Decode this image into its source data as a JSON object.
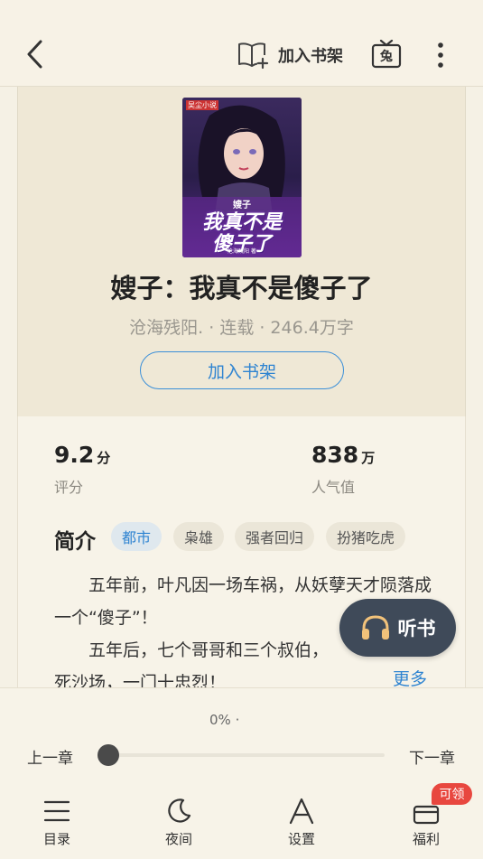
{
  "topbar": {
    "add_shelf_label": "加入书架",
    "tv_icon_text": "兔"
  },
  "book": {
    "cover_publisher": "吴尘小说",
    "cover_title_small": "嫂子",
    "cover_title_big_line1": "我真不是",
    "cover_title_big_line2": "傻子了",
    "cover_author_tag": "沧海残阳 著",
    "title": "嫂子：我真不是傻子了",
    "meta": "沧海残阳. · 连载 · 246.4万字",
    "add_button": "加入书架"
  },
  "stats": {
    "rating_value": "9.2",
    "rating_unit": "分",
    "rating_label": "评分",
    "popularity_value": "838",
    "popularity_unit": "万",
    "popularity_label": "人气值"
  },
  "intro": {
    "heading": "简介",
    "tags": [
      "都市",
      "枭雄",
      "强者回归",
      "扮猪吃虎"
    ],
    "para1": "五年前，叶凡因一场车祸，从妖孽天才陨落成一个“傻子”！",
    "para2": "五年后，七个哥哥和三个叔伯，",
    "para3": "死沙场，一门十忠烈！",
    "more": "更多"
  },
  "listen": {
    "label": "听书"
  },
  "reader": {
    "progress_text": "0% ·",
    "progress": 0,
    "prev": "上一章",
    "next": "下一章"
  },
  "nav": {
    "catalog": "目录",
    "night": "夜间",
    "settings": "设置",
    "welfare": "福利",
    "badge": "可领"
  },
  "colors": {
    "accent": "#2f84d1",
    "badge": "#e8473f",
    "listen_bg": "#3f4a59"
  }
}
